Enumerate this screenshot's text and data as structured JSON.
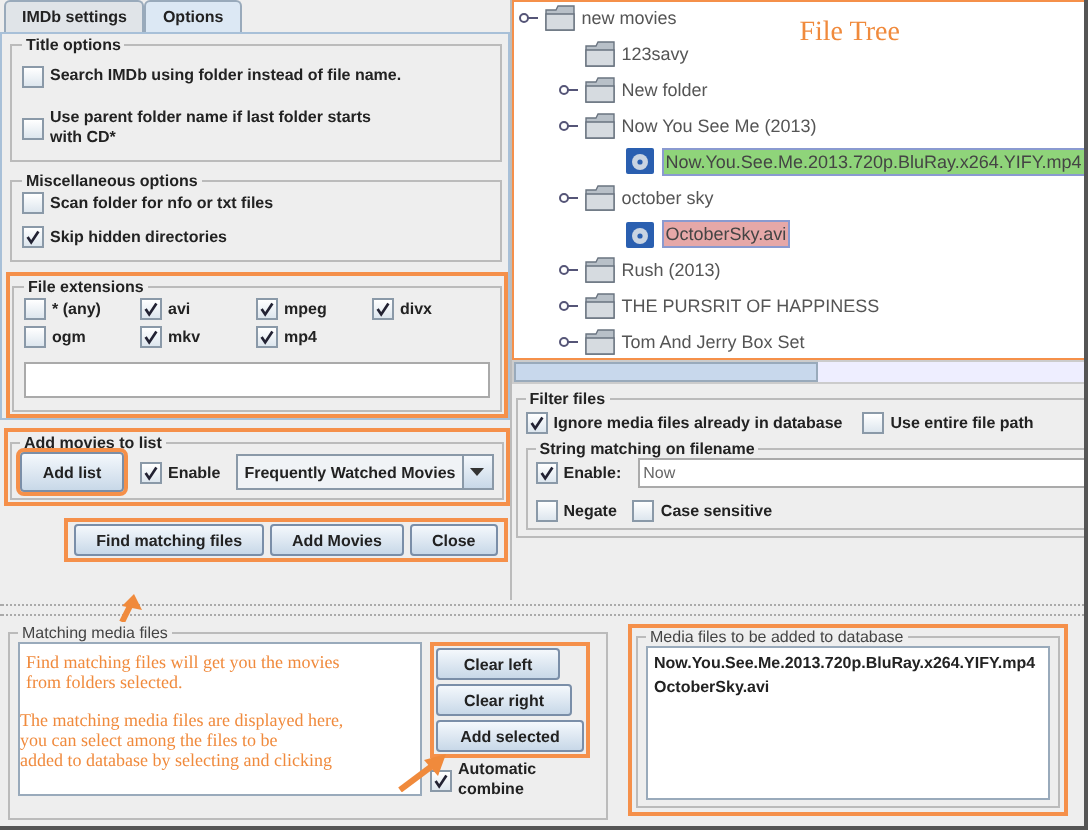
{
  "tabs": [
    {
      "label": "IMDb settings",
      "selected": false
    },
    {
      "label": "Options",
      "selected": true
    }
  ],
  "title_options": {
    "title": "Title options",
    "checkboxes": [
      {
        "label": "Search IMDb using folder instead of file name.",
        "checked": false
      },
      {
        "label": "Use parent folder name if last folder starts with CD*",
        "checked": false
      }
    ]
  },
  "misc_options": {
    "title": "Miscellaneous options",
    "checkboxes": [
      {
        "label": "Scan folder for nfo or txt files",
        "checked": false
      },
      {
        "label": "Skip hidden directories",
        "checked": true
      }
    ]
  },
  "file_extensions": {
    "title": "File extensions",
    "highlighted": true,
    "checkboxes": [
      {
        "label": "* (any)",
        "checked": false
      },
      {
        "label": "avi",
        "checked": true
      },
      {
        "label": "mpeg",
        "checked": true
      },
      {
        "label": "divx",
        "checked": true
      },
      {
        "label": "ogm",
        "checked": false
      },
      {
        "label": "mkv",
        "checked": true
      },
      {
        "label": "mp4",
        "checked": true
      }
    ]
  },
  "add_movies": {
    "title": "Add movies to list",
    "highlighted": true,
    "button": "Add list",
    "button_highlighted": true,
    "enable": {
      "label": "Enable",
      "checked": true
    },
    "list": "Frequently Watched Movies"
  },
  "actions": {
    "highlighted": true,
    "buttons": [
      "Find matching files",
      "Add Movies",
      "Close"
    ]
  },
  "file_tree": {
    "annotation": "File Tree",
    "highlighted": true,
    "items": [
      {
        "label": "new movies",
        "kind": "folder",
        "expandable": true,
        "children": [
          {
            "label": "123savy",
            "kind": "folder",
            "expandable": false
          },
          {
            "label": "New folder",
            "kind": "folder",
            "expandable": true
          },
          {
            "label": "Now You See Me (2013)",
            "kind": "folder",
            "expandable": true,
            "children": [
              {
                "label": "Now.You.See.Me.2013.720p.BluRay.x264.YIFY.mp4",
                "kind": "file",
                "color": "#8fd47a"
              }
            ]
          },
          {
            "label": "october sky",
            "kind": "folder",
            "expandable": true,
            "children": [
              {
                "label": "OctoberSky.avi",
                "kind": "file",
                "color": "#e6a8a8"
              }
            ]
          },
          {
            "label": "Rush (2013)",
            "kind": "folder",
            "expandable": true
          },
          {
            "label": "THE PURSRIT OF HAPPINESS",
            "kind": "folder",
            "expandable": true
          },
          {
            "label": "Tom And Jerry Box Set",
            "kind": "folder",
            "expandable": true
          }
        ]
      }
    ]
  },
  "filter": {
    "title": "Filter files",
    "checkboxes": [
      {
        "label": "Ignore media files already in database",
        "checked": true
      },
      {
        "label": "Use entire file path",
        "checked": false
      }
    ],
    "string_matching": {
      "title": "String matching on filename",
      "enable": {
        "label": "Enable:",
        "checked": true
      },
      "value": "Now",
      "options": [
        {
          "label": "Negate",
          "checked": false
        },
        {
          "label": "Case sensitive",
          "checked": false
        }
      ]
    }
  },
  "matching": {
    "title": "Matching media files",
    "annotations": [
      [
        "Find matching files will get you the movies",
        "from folders selected."
      ],
      [
        "The matching media files are displayed here,",
        "you can select among the files to be",
        "added to database by selecting and clicking"
      ]
    ],
    "buttons": [
      "Clear left",
      "Clear right",
      "Add selected"
    ],
    "buttons_highlighted": true,
    "automatic_combine": {
      "label": "Automatic combine",
      "checked": true
    }
  },
  "media": {
    "title": "Media files to be added to database",
    "highlighted": true,
    "files": [
      "Now.You.See.Me.2013.720p.BluRay.x264.YIFY.mp4",
      "OctoberSky.avi"
    ]
  }
}
